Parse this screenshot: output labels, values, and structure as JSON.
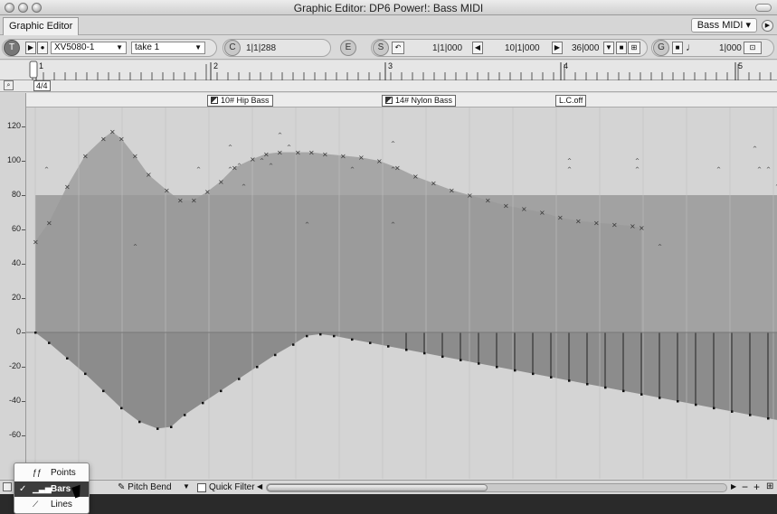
{
  "window": {
    "title": "Graphic Editor: DP6 Power!: Bass MIDI"
  },
  "tabs": {
    "graphic_editor": "Graphic Editor",
    "track_menu": "Bass MIDI ▾"
  },
  "toolbar": {
    "t_button": "T",
    "device": "XV5080-1",
    "take": "take 1",
    "c_button": "C",
    "counter": "1|1|288",
    "e_button": "E",
    "s_button": "S",
    "start_pos": "1|1|000",
    "mid_pos": "10|1|000",
    "end_pos": "36|000",
    "g_button": "G",
    "grid_value": "1|000"
  },
  "ruler": {
    "bars": [
      "1",
      "2",
      "3",
      "4",
      "5"
    ],
    "time_signature": "4/4"
  },
  "patches": [
    {
      "label": "10# Hip Bass"
    },
    {
      "label": "14# Nylon Bass"
    },
    {
      "label": "L.C.off"
    }
  ],
  "y_axis_labels": [
    "120",
    "100",
    "80",
    "60",
    "40",
    "20",
    "0",
    "-20",
    "-40",
    "-60"
  ],
  "graph": {
    "colors": {
      "background": "#d4d4d4",
      "upper_fill": "#a6a6a6",
      "band_fill": "#999999",
      "lower_fill": "#8c8c8c",
      "marker": "#333333"
    },
    "upper_curve": [
      [
        0,
        53
      ],
      [
        15,
        64
      ],
      [
        35,
        85
      ],
      [
        55,
        103
      ],
      [
        75,
        113
      ],
      [
        85,
        117
      ],
      [
        95,
        113
      ],
      [
        110,
        103
      ],
      [
        125,
        92
      ],
      [
        145,
        83
      ],
      [
        160,
        77
      ],
      [
        175,
        77
      ],
      [
        190,
        82
      ],
      [
        205,
        88
      ],
      [
        220,
        96
      ],
      [
        240,
        101
      ],
      [
        255,
        104
      ],
      [
        270,
        105
      ],
      [
        290,
        105
      ],
      [
        305,
        105
      ],
      [
        320,
        104
      ],
      [
        340,
        103
      ],
      [
        360,
        102
      ],
      [
        380,
        100
      ],
      [
        400,
        96
      ],
      [
        420,
        91
      ],
      [
        440,
        87
      ],
      [
        460,
        83
      ],
      [
        480,
        80
      ],
      [
        500,
        77
      ],
      [
        520,
        74
      ],
      [
        540,
        72
      ],
      [
        560,
        70
      ],
      [
        580,
        67
      ],
      [
        600,
        65
      ],
      [
        620,
        64
      ],
      [
        640,
        63
      ],
      [
        660,
        62
      ],
      [
        670,
        61
      ]
    ],
    "band_level": 80,
    "lower_curve": [
      [
        0,
        0
      ],
      [
        15,
        -6
      ],
      [
        35,
        -15
      ],
      [
        55,
        -24
      ],
      [
        75,
        -34
      ],
      [
        95,
        -44
      ],
      [
        115,
        -52
      ],
      [
        135,
        -56
      ],
      [
        150,
        -55
      ],
      [
        165,
        -48
      ],
      [
        185,
        -41
      ],
      [
        205,
        -34
      ],
      [
        225,
        -27
      ],
      [
        245,
        -20
      ],
      [
        265,
        -13
      ],
      [
        285,
        -7
      ],
      [
        300,
        -2
      ],
      [
        315,
        -1
      ],
      [
        330,
        -2
      ],
      [
        350,
        -4
      ],
      [
        370,
        -6
      ],
      [
        390,
        -8
      ],
      [
        410,
        -10
      ],
      [
        430,
        -12
      ],
      [
        450,
        -14
      ],
      [
        470,
        -16
      ],
      [
        490,
        -18
      ],
      [
        510,
        -20
      ],
      [
        530,
        -22
      ],
      [
        550,
        -24
      ],
      [
        570,
        -26
      ],
      [
        590,
        -28
      ],
      [
        610,
        -30
      ],
      [
        630,
        -32
      ],
      [
        650,
        -34
      ],
      [
        670,
        -36
      ],
      [
        690,
        -38
      ],
      [
        710,
        -40
      ],
      [
        730,
        -42
      ],
      [
        750,
        -44
      ],
      [
        770,
        -46
      ],
      [
        790,
        -48
      ],
      [
        810,
        -50
      ],
      [
        830,
        -52
      ]
    ],
    "scatter_points": [
      [
        12,
        95
      ],
      [
        110,
        50
      ],
      [
        180,
        95
      ],
      [
        215,
        95
      ],
      [
        225,
        97
      ],
      [
        215,
        108
      ],
      [
        230,
        85
      ],
      [
        250,
        100
      ],
      [
        260,
        97
      ],
      [
        300,
        63
      ],
      [
        270,
        115
      ],
      [
        280,
        108
      ],
      [
        350,
        95
      ],
      [
        395,
        110
      ],
      [
        395,
        95
      ],
      [
        395,
        63
      ],
      [
        590,
        95
      ],
      [
        590,
        100
      ],
      [
        665,
        95
      ],
      [
        665,
        100
      ],
      [
        690,
        50
      ],
      [
        755,
        95
      ],
      [
        795,
        107
      ],
      [
        800,
        95
      ],
      [
        810,
        95
      ],
      [
        820,
        85
      ],
      [
        825,
        100
      ]
    ]
  },
  "bottom": {
    "controller": "Pitch Bend",
    "quick_filter": "Quick Filter"
  },
  "popup_menu": {
    "items": [
      {
        "label": "Points",
        "icon": "ff"
      },
      {
        "label": "Bars",
        "icon": "bars"
      },
      {
        "label": "Lines",
        "icon": "lines"
      }
    ]
  }
}
